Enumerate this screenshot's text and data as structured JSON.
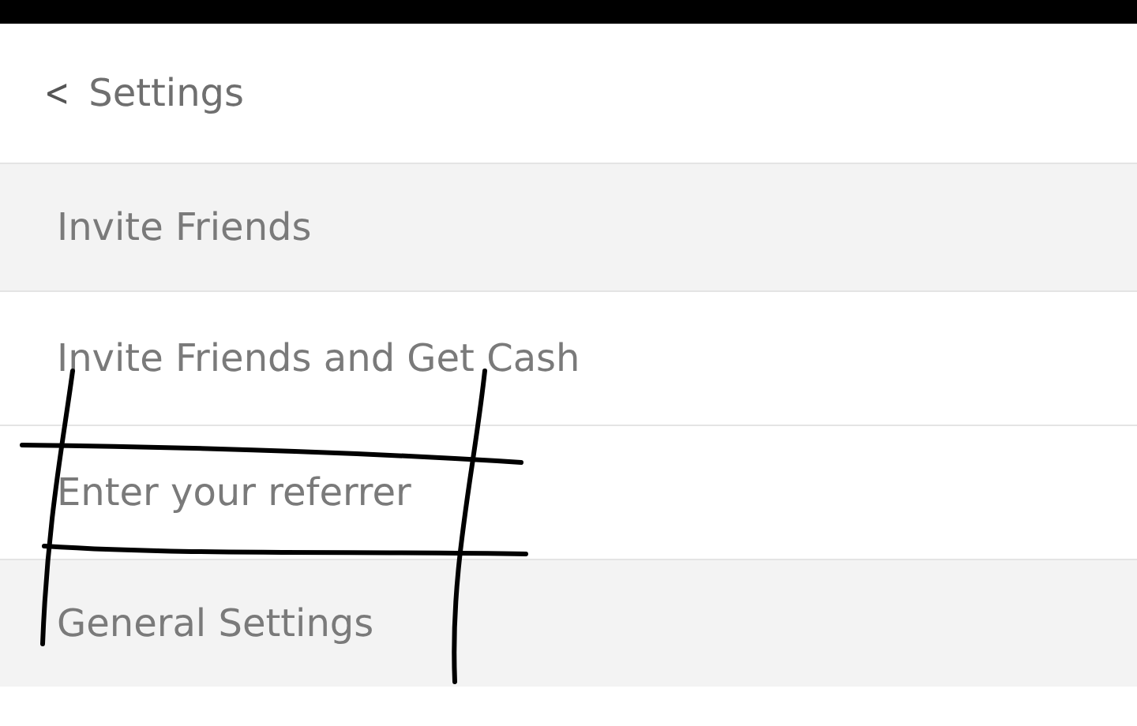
{
  "header": {
    "back_icon": "<",
    "title": "Settings"
  },
  "rows": [
    {
      "kind": "section",
      "label": "Invite Friends"
    },
    {
      "kind": "item",
      "label": "Invite Friends and Get Cash"
    },
    {
      "kind": "item",
      "label": "Enter your referrer"
    },
    {
      "kind": "section",
      "label": "General Settings"
    }
  ]
}
